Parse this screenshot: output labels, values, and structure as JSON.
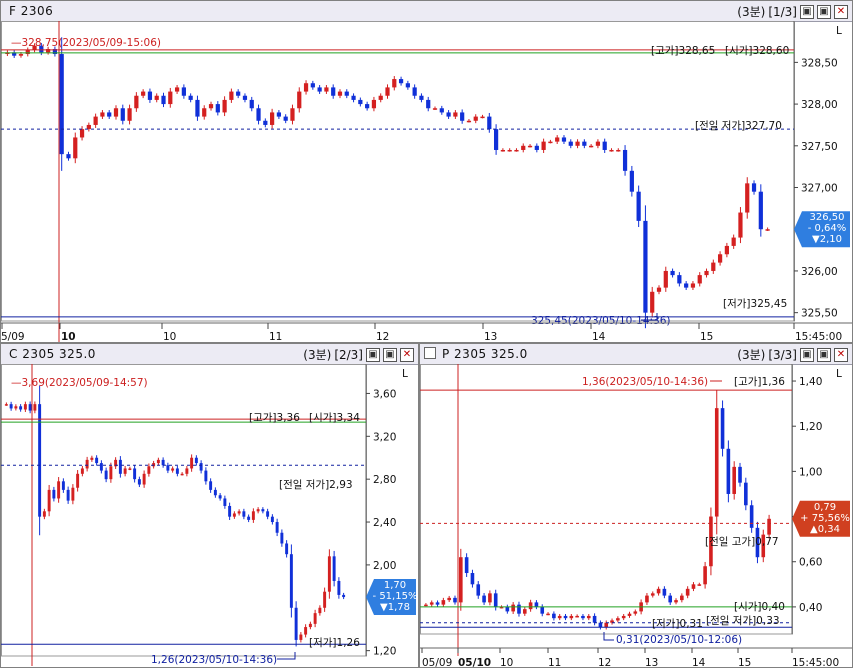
{
  "panels": {
    "futures": {
      "title": "F 2306",
      "period": "(3분)",
      "page": "[1/3]",
      "y_ticks": [
        "328,50",
        "328,00",
        "327,50",
        "327,00",
        "326,00",
        "325,50"
      ],
      "y_tick_values": [
        328.5,
        328.0,
        327.5,
        327.0,
        326.0,
        325.5
      ],
      "x_ticks": [
        "5/09",
        "10",
        "10",
        "11",
        "12",
        "13",
        "14",
        "15",
        "15:45:00"
      ],
      "ref_top_label": "328,75(2023/05/09-15:06)",
      "high_label": "[고가]328,65",
      "open_label": "[시가]328,60",
      "prev_low_label": "[전일 저가]327,70",
      "low_label": "[저가]325,45",
      "low_marker_label": "325,45(2023/05/10-14:36)",
      "badge": {
        "price": "326,50",
        "pct": "- 0,64%",
        "chg": "▼2,10",
        "color": "#2f7ee0"
      },
      "colors": {
        "up": "#d42020",
        "down": "#1020d0",
        "high_line": "#cc2020",
        "open_line": "#20a020",
        "prev_line": "#1020a0"
      }
    },
    "call": {
      "title": "C 2305 325.0",
      "period": "(3분)",
      "page": "[2/3]",
      "y_ticks": [
        "3,60",
        "3,20",
        "2,80",
        "2,40",
        "2,00",
        "1,20"
      ],
      "y_tick_values": [
        3.6,
        3.2,
        2.8,
        2.4,
        2.0,
        1.2
      ],
      "ref_top_label": "3,69(2023/05/09-14:57)",
      "high_label": "[고가]3,36",
      "open_label": "[시가]3,34",
      "prev_low_label": "[전일 저가]2,93",
      "low_label": "[저가]1,26",
      "low_marker_label": "1,26(2023/05/10-14:36)",
      "badge": {
        "price": "1,70",
        "pct": "- 51,15%",
        "chg": "▼1,78",
        "color": "#2f7ee0"
      }
    },
    "put": {
      "title": "P 2305 325.0",
      "period": "(3분)",
      "page": "[3/3]",
      "y_ticks": [
        "1,40",
        "1,20",
        "1,00",
        "0,80",
        "0,60",
        "0,40"
      ],
      "y_tick_values": [
        1.4,
        1.2,
        1.0,
        0.8,
        0.6,
        0.4
      ],
      "x_ticks": [
        "05/09",
        "05/10",
        "10",
        "11",
        "12",
        "13",
        "14",
        "15",
        "15:45:00"
      ],
      "ref_top_label": "1,36(2023/05/10-14:36)",
      "high_label": "[고가]1,36",
      "prev_high_label": "[전일 고가]0,77",
      "open_label": "[시가]0,40",
      "prev_low_label": "[전일 저가]0,33",
      "low_label": "[저가]0,31",
      "low_marker_label": "0,31(2023/05/10-12:06)",
      "badge": {
        "price": "0,79",
        "pct": "+ 75,56%",
        "chg": "▲0,34",
        "color": "#d04020"
      }
    }
  },
  "chart_data": [
    {
      "type": "candlestick",
      "title": "F 2306",
      "ylim": [
        325.4,
        328.9
      ],
      "close": [
        328.62,
        328.58,
        328.6,
        328.65,
        328.7,
        328.62,
        328.66,
        328.6,
        327.4,
        327.35,
        327.6,
        327.7,
        327.75,
        327.85,
        327.9,
        327.85,
        327.95,
        327.8,
        327.95,
        328.1,
        328.15,
        328.05,
        328.1,
        328.0,
        328.15,
        328.2,
        328.1,
        328.05,
        327.85,
        327.95,
        328.0,
        327.9,
        328.05,
        328.15,
        328.1,
        328.05,
        327.95,
        327.8,
        327.75,
        327.9,
        327.85,
        327.8,
        327.95,
        328.15,
        328.25,
        328.2,
        328.15,
        328.2,
        328.1,
        328.15,
        328.1,
        328.05,
        328.0,
        327.95,
        328.05,
        328.1,
        328.2,
        328.3,
        328.25,
        328.2,
        328.1,
        328.05,
        327.95,
        327.95,
        327.9,
        327.85,
        327.9,
        327.8,
        327.8,
        327.85,
        327.85,
        327.7,
        327.45,
        327.45,
        327.45,
        327.45,
        327.5,
        327.5,
        327.45,
        327.55,
        327.55,
        327.6,
        327.55,
        327.5,
        327.55,
        327.5,
        327.5,
        327.55,
        327.45,
        327.45,
        327.45,
        327.2,
        326.95,
        326.6,
        325.5,
        325.75,
        325.8,
        326.0,
        325.95,
        325.85,
        325.8,
        325.85,
        325.95,
        326.0,
        326.1,
        326.2,
        326.3,
        326.4,
        326.7,
        327.05,
        326.95,
        326.5,
        326.5
      ],
      "open": [
        328.6,
        328.62,
        328.58,
        328.6,
        328.65,
        328.7,
        328.62,
        328.66,
        328.6,
        327.4,
        327.35,
        327.6,
        327.7,
        327.75,
        327.85,
        327.9,
        327.85,
        327.95,
        327.8,
        327.95,
        328.1,
        328.15,
        328.05,
        328.1,
        328.0,
        328.15,
        328.2,
        328.1,
        328.05,
        327.85,
        327.95,
        328.0,
        327.9,
        328.05,
        328.15,
        328.1,
        328.05,
        327.95,
        327.8,
        327.75,
        327.9,
        327.85,
        327.8,
        327.95,
        328.15,
        328.25,
        328.2,
        328.15,
        328.2,
        328.1,
        328.15,
        328.1,
        328.05,
        328.0,
        327.95,
        328.05,
        328.1,
        328.2,
        328.3,
        328.25,
        328.2,
        328.1,
        328.05,
        327.95,
        327.95,
        327.9,
        327.85,
        327.9,
        327.8,
        327.8,
        327.85,
        327.85,
        327.7,
        327.45,
        327.45,
        327.45,
        327.45,
        327.5,
        327.5,
        327.45,
        327.55,
        327.55,
        327.6,
        327.55,
        327.5,
        327.55,
        327.5,
        327.5,
        327.55,
        327.45,
        327.45,
        327.45,
        327.2,
        326.95,
        326.6,
        325.5,
        325.75,
        325.8,
        326.0,
        325.95,
        325.85,
        325.8,
        325.85,
        325.95,
        326.0,
        326.1,
        326.2,
        326.3,
        326.4,
        326.7,
        327.05,
        326.95,
        326.5
      ],
      "high": 328.65,
      "low": 325.45,
      "last": 326.5
    },
    {
      "type": "candlestick",
      "title": "C 2305 325.0",
      "ylim": [
        1.15,
        3.8
      ],
      "close": [
        3.5,
        3.46,
        3.48,
        3.45,
        3.5,
        3.44,
        3.5,
        2.45,
        2.5,
        2.7,
        2.62,
        2.78,
        2.7,
        2.6,
        2.72,
        2.85,
        2.9,
        2.98,
        3.0,
        2.95,
        2.88,
        2.8,
        2.92,
        2.98,
        2.85,
        2.9,
        2.9,
        2.8,
        2.75,
        2.85,
        2.92,
        2.95,
        2.98,
        2.93,
        2.88,
        2.9,
        2.85,
        2.85,
        2.9,
        3.0,
        2.95,
        2.88,
        2.78,
        2.7,
        2.65,
        2.62,
        2.55,
        2.45,
        2.48,
        2.5,
        2.45,
        2.42,
        2.5,
        2.52,
        2.5,
        2.45,
        2.4,
        2.3,
        2.2,
        2.1,
        1.6,
        1.3,
        1.35,
        1.42,
        1.45,
        1.55,
        1.6,
        1.75,
        2.08,
        1.85,
        1.72,
        1.7
      ],
      "high": 3.36,
      "low": 1.26,
      "last": 1.7
    },
    {
      "type": "candlestick",
      "title": "P 2305 325.0",
      "ylim": [
        0.28,
        1.44
      ],
      "close": [
        0.41,
        0.42,
        0.41,
        0.43,
        0.44,
        0.42,
        0.62,
        0.55,
        0.5,
        0.45,
        0.42,
        0.46,
        0.4,
        0.4,
        0.38,
        0.41,
        0.37,
        0.39,
        0.42,
        0.4,
        0.37,
        0.37,
        0.35,
        0.36,
        0.35,
        0.36,
        0.36,
        0.35,
        0.36,
        0.33,
        0.31,
        0.33,
        0.34,
        0.35,
        0.36,
        0.37,
        0.38,
        0.42,
        0.45,
        0.46,
        0.48,
        0.45,
        0.42,
        0.43,
        0.45,
        0.48,
        0.5,
        0.5,
        0.58,
        0.8,
        1.28,
        1.1,
        0.9,
        1.02,
        0.95,
        0.85,
        0.75,
        0.62,
        0.72,
        0.79
      ],
      "high": 1.36,
      "low": 0.31,
      "last": 0.79
    }
  ]
}
